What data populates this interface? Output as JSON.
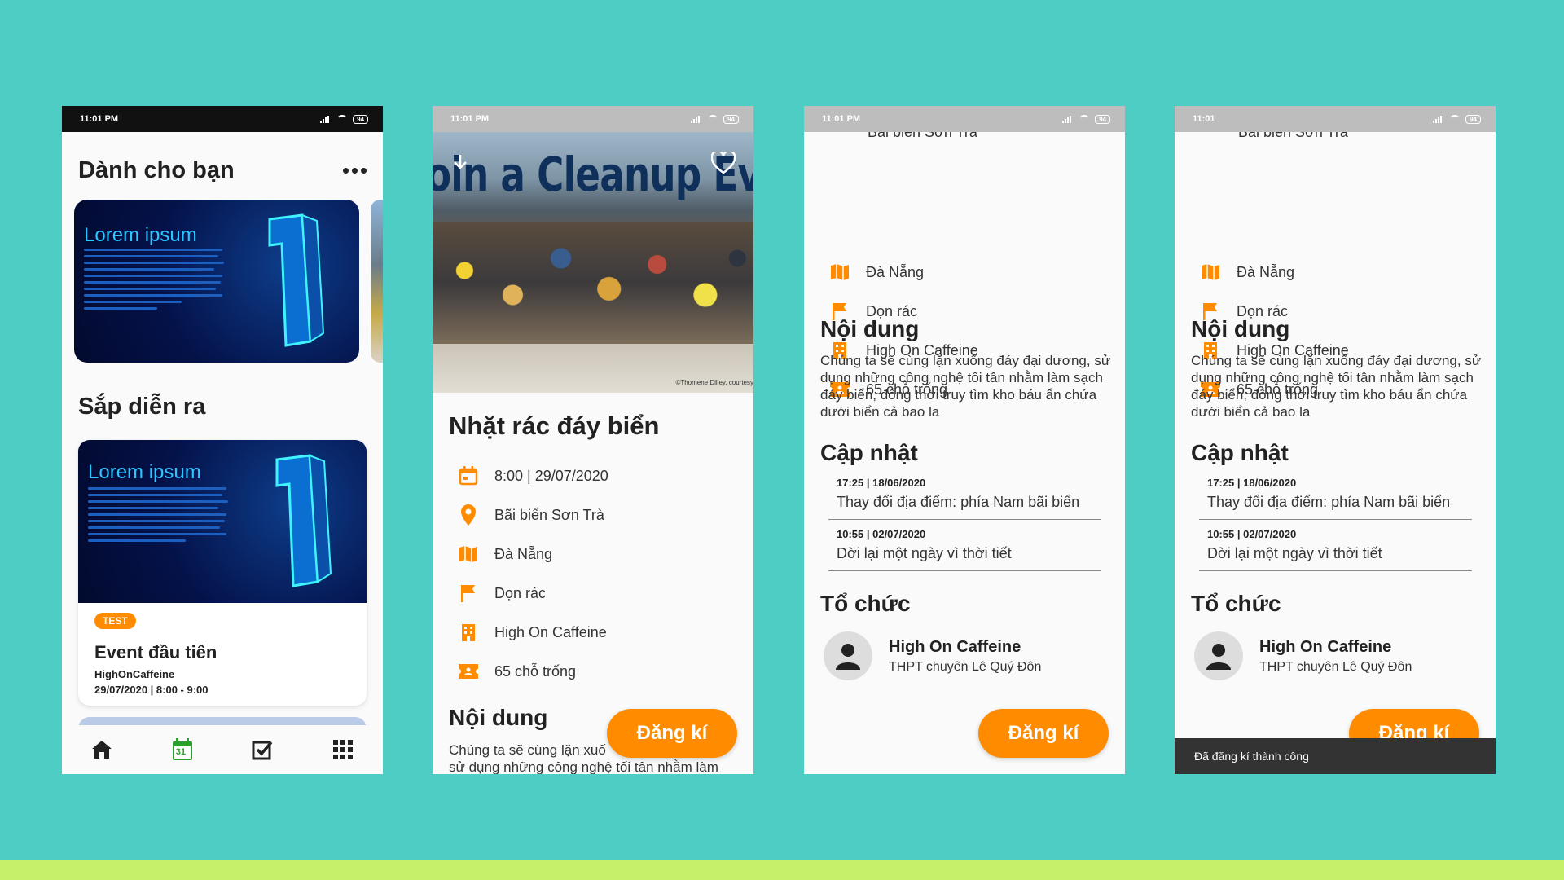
{
  "status_time": "11:01 PM",
  "status_time_short": "11:01",
  "battery": "94",
  "accent": "#ff8c00",
  "screen1": {
    "title": "Dành cho bạn",
    "hero_text": "Lorem ipsum",
    "section": "Sắp diễn ra",
    "event": {
      "tag": "TEST",
      "image_text": "Lorem ipsum",
      "title": "Event đầu tiên",
      "organizer": "HighOnCaffeine",
      "datetime": "29/07/2020 | 8:00 - 9:00"
    },
    "nav": {
      "home_icon": "home-icon",
      "calendar_icon": "calendar-icon",
      "calendar_day": "31",
      "tasks_icon": "checklist-icon",
      "apps_icon": "grid-icon"
    }
  },
  "screen2": {
    "banner_text": "oin a Cleanup Event",
    "banner_credit": "©Thomene Dilley, courtesy",
    "title": "Nhặt rác đáy biển",
    "info": {
      "datetime": "8:00 | 29/07/2020",
      "location": "Bãi biển Sơn Trà",
      "city": "Đà Nẵng",
      "category": "Dọn rác",
      "organizer": "High On Caffeine",
      "slots": "65 chỗ trống"
    },
    "content_title": "Nội dung",
    "content_line1": "Chúng ta sẽ cùng lặn xuố",
    "content_line2": "sử dụng những công nghệ tối tân nhằm làm",
    "register": "Đăng kí"
  },
  "screen3": {
    "cut_text": "Bãi biển Sơn Trà",
    "content_title": "Nội dung",
    "content": "Chúng ta sẽ cùng lặn xuống đáy đại dương, sử dụng những công nghệ tối tân nhằm làm sạch đáy biển, đồng thời truy tìm kho báu ẩn chứa dưới biển cả bao la",
    "updates_title": "Cập nhật",
    "updates": [
      {
        "time": "17:25 | 18/06/2020",
        "text": "Thay đổi địa điểm: phía Nam bãi biển"
      },
      {
        "time": "10:55 | 02/07/2020",
        "text": "Dời lại một ngày vì thời tiết"
      }
    ],
    "org_title": "Tổ chức",
    "org_name": "High On Caffeine",
    "org_sub": "THPT chuyên Lê Quý Đôn",
    "register": "Đăng kí"
  },
  "screen4": {
    "toast": "Đã đăng kí thành công"
  }
}
